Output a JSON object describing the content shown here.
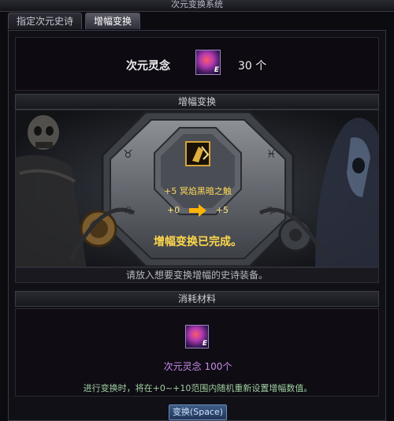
{
  "window": {
    "title": "次元变换系统"
  },
  "tabs": [
    {
      "label": "指定次元史诗",
      "active": false
    },
    {
      "label": "增幅变换",
      "active": true
    }
  ],
  "spirit": {
    "label": "次元灵念",
    "icon": "dimension-spirit-icon",
    "icon_badge": "E",
    "count": "30 个"
  },
  "sections": {
    "amplify": "增幅变换",
    "materials": "消耗材料"
  },
  "amplify": {
    "item_prefix": "+5",
    "item_name": "冥焰黑暗之触",
    "from_value": "+0",
    "to_value": "+5",
    "arrow_icon": "arrow-right-icon",
    "result_text": "增幅变换已完成。",
    "hint": "请放入想要变换增幅的史诗装备。"
  },
  "material": {
    "icon": "dimension-spirit-icon",
    "icon_badge": "E",
    "name": "次元灵念 100个",
    "description": "进行变换时，将在+0~+10范围内随机重新设置增幅数值。"
  },
  "button": {
    "convert_label": "变换(Space)"
  },
  "colors": {
    "gold": "#ffd84a",
    "purple_text": "#c98be9",
    "green_text": "#9fcf9f",
    "button_blue": "#2f4a72"
  }
}
